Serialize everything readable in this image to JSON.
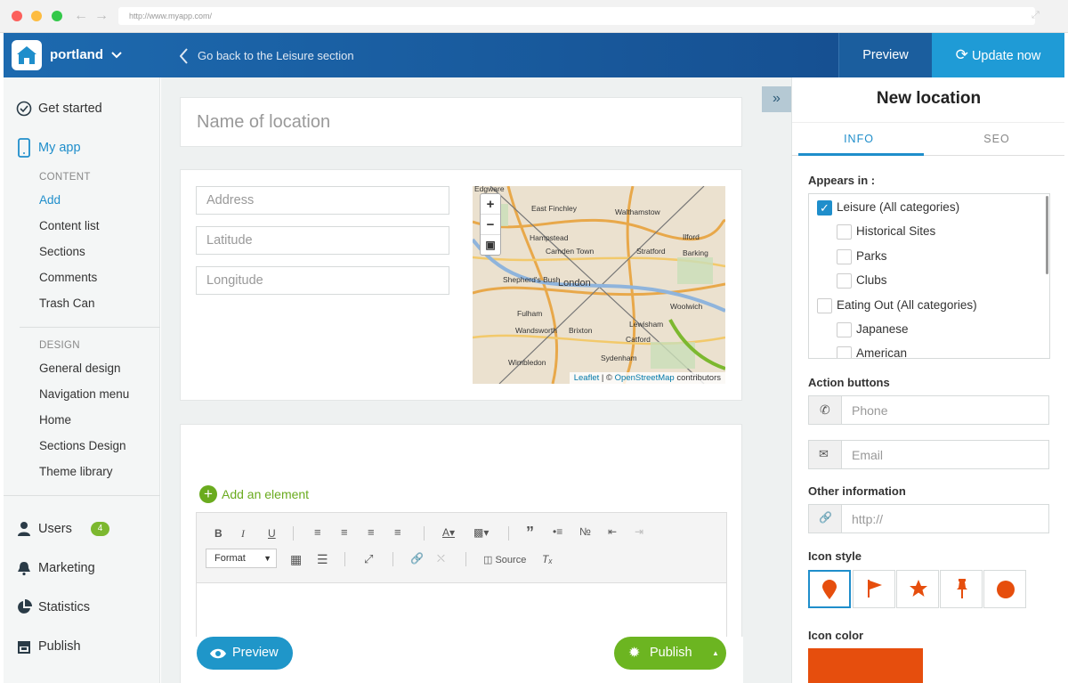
{
  "browser": {
    "url": "http://www.myapp.com/"
  },
  "topbar": {
    "app_name": "portland",
    "back_label": "Go back to the Leisure section",
    "preview_label": "Preview",
    "update_label": "Update now"
  },
  "sidebar": {
    "get_started": "Get started",
    "my_app": "My app",
    "content_header": "CONTENT",
    "content_items": [
      "Add",
      "Content list",
      "Sections",
      "Comments",
      "Trash Can"
    ],
    "design_header": "DESIGN",
    "design_items": [
      "General design",
      "Navigation menu",
      "Home",
      "Sections Design",
      "Theme library"
    ],
    "users": "Users",
    "users_badge": "4",
    "marketing": "Marketing",
    "statistics": "Statistics",
    "publish": "Publish"
  },
  "main": {
    "name_placeholder": "Name of location",
    "address_placeholder": "Address",
    "latitude_placeholder": "Latitude",
    "longitude_placeholder": "Longitude",
    "map": {
      "labels": [
        "Edgware",
        "East Finchley",
        "Walthamstow",
        "Hampstead",
        "Camden Town",
        "Ilford",
        "Stratford",
        "Barking",
        "Shepherd's Bush",
        "London",
        "Woolwich",
        "Fulham",
        "Wandsworth",
        "Brixton",
        "Lewisham",
        "Catford",
        "Wimbledon",
        "Sydenham"
      ],
      "attribution_leaflet": "Leaflet",
      "attribution_sep": " | © ",
      "attribution_osm": "OpenStreetMap",
      "attribution_tail": " contributors"
    },
    "add_element": "Add an element",
    "editor": {
      "format_label": "Format",
      "source_label": "Source"
    },
    "preview_button": "Preview",
    "publish_button": "Publish"
  },
  "panel": {
    "title": "New location",
    "tabs": [
      "INFO",
      "SEO"
    ],
    "appears_in_label": "Appears in :",
    "categories": [
      {
        "label": "Leisure (All categories)",
        "checked": true,
        "indent": 0
      },
      {
        "label": "Historical Sites",
        "checked": false,
        "indent": 1
      },
      {
        "label": "Parks",
        "checked": false,
        "indent": 1
      },
      {
        "label": "Clubs",
        "checked": false,
        "indent": 1
      },
      {
        "label": "Eating Out (All categories)",
        "checked": false,
        "indent": 0
      },
      {
        "label": "Japanese",
        "checked": false,
        "indent": 1
      },
      {
        "label": "American",
        "checked": false,
        "indent": 1
      }
    ],
    "action_buttons_label": "Action buttons",
    "phone_placeholder": "Phone",
    "email_placeholder": "Email",
    "other_info_label": "Other information",
    "url_placeholder": "http://",
    "icon_style_label": "Icon style",
    "icon_styles": [
      "map-pin-icon",
      "flag-icon",
      "star-icon",
      "pushpin-icon",
      "circle-icon"
    ],
    "icon_color_label": "Icon color",
    "icon_color": "#e64e0d"
  }
}
